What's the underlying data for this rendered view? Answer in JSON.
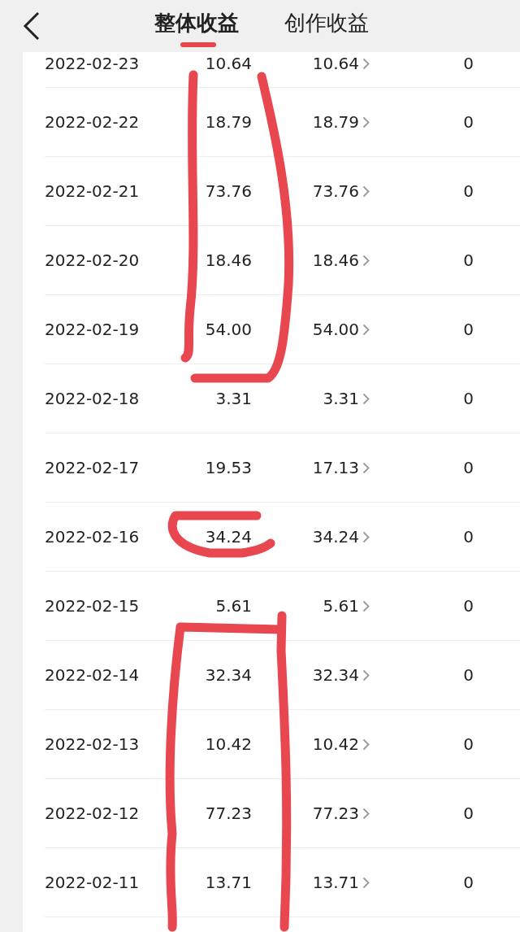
{
  "tabs": [
    {
      "label": "整体收益",
      "selected": true
    },
    {
      "label": "创作收益",
      "selected": false
    }
  ],
  "rows": [
    {
      "date": "2022-02-23",
      "total": "10.64",
      "creation": "10.64",
      "other": "0"
    },
    {
      "date": "2022-02-22",
      "total": "18.79",
      "creation": "18.79",
      "other": "0"
    },
    {
      "date": "2022-02-21",
      "total": "73.76",
      "creation": "73.76",
      "other": "0"
    },
    {
      "date": "2022-02-20",
      "total": "18.46",
      "creation": "18.46",
      "other": "0"
    },
    {
      "date": "2022-02-19",
      "total": "54.00",
      "creation": "54.00",
      "other": "0"
    },
    {
      "date": "2022-02-18",
      "total": "3.31",
      "creation": "3.31",
      "other": "0"
    },
    {
      "date": "2022-02-17",
      "total": "19.53",
      "creation": "17.13",
      "other": "0"
    },
    {
      "date": "2022-02-16",
      "total": "34.24",
      "creation": "34.24",
      "other": "0"
    },
    {
      "date": "2022-02-15",
      "total": "5.61",
      "creation": "5.61",
      "other": "0"
    },
    {
      "date": "2022-02-14",
      "total": "32.34",
      "creation": "32.34",
      "other": "0"
    },
    {
      "date": "2022-02-13",
      "total": "10.42",
      "creation": "10.42",
      "other": "0"
    },
    {
      "date": "2022-02-12",
      "total": "77.23",
      "creation": "77.23",
      "other": "0"
    },
    {
      "date": "2022-02-11",
      "total": "13.71",
      "creation": "13.71",
      "other": "0"
    }
  ]
}
